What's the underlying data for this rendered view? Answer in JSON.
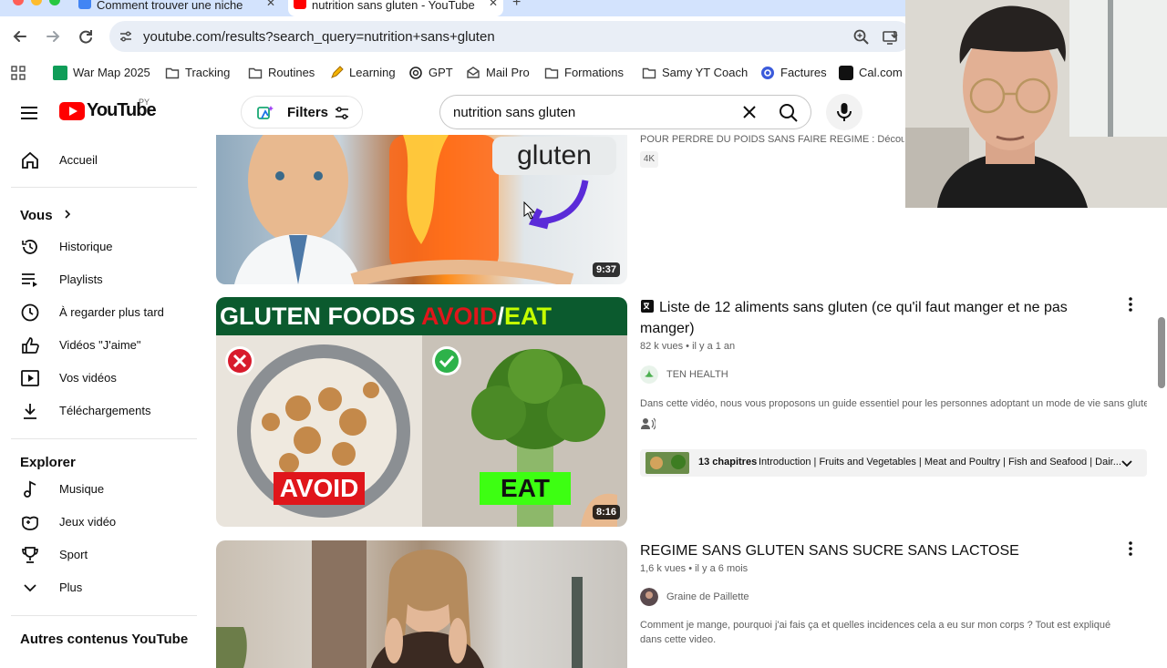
{
  "browser": {
    "tabs": [
      {
        "label": "Comment trouver une niche",
        "active": false
      },
      {
        "label": "nutrition sans gluten - YouTube",
        "active": true
      }
    ],
    "url": "youtube.com/results?search_query=nutrition+sans+gluten",
    "bookmarks": [
      {
        "label": "War Map 2025",
        "icon": "sheets-icon"
      },
      {
        "label": "Tracking",
        "icon": "folder-icon"
      },
      {
        "label": "Routines",
        "icon": "folder-icon"
      },
      {
        "label": "Learning",
        "icon": "pencil-icon"
      },
      {
        "label": "GPT",
        "icon": "openai-icon"
      },
      {
        "label": "Mail Pro",
        "icon": "mail-icon"
      },
      {
        "label": "Formations",
        "icon": "folder-icon"
      },
      {
        "label": "Samy YT Coach",
        "icon": "folder-icon"
      },
      {
        "label": "Factures",
        "icon": "circle-icon"
      },
      {
        "label": "Cal.com",
        "icon": "cal-icon"
      }
    ]
  },
  "header": {
    "logo": "YouTube",
    "country": "PY",
    "filters_label": "Filters",
    "search_query": "nutrition sans gluten"
  },
  "sidebar": {
    "home": "Accueil",
    "you_heading": "Vous",
    "you_items": [
      "Historique",
      "Playlists",
      "À regarder plus tard",
      "Vidéos \"J'aime\"",
      "Vos vidéos",
      "Téléchargements"
    ],
    "explore_heading": "Explorer",
    "explore_items": [
      "Musique",
      "Jeux vidéo",
      "Sport",
      "Plus"
    ],
    "other_heading": "Autres contenus YouTube"
  },
  "results": [
    {
      "duration": "9:37",
      "thumb_text": "gluten",
      "desc": "POUR PERDRE DU POIDS SANS FAIRE REGIME : Découvrez m",
      "badge": "4K"
    },
    {
      "duration": "8:16",
      "thumb_banner": [
        "GLUTEN FOODS ",
        "AVOID",
        "/",
        "EAT"
      ],
      "thumb_avoid": "AVOID",
      "thumb_eat": "EAT",
      "title": "Liste de 12 aliments sans gluten (ce qu'il faut manger et ne pas manger)",
      "views": "82 k vues",
      "age": "il y a 1 an",
      "channel": "TEN HEALTH",
      "desc": "Dans cette vidéo, nous vous proposons un guide essentiel pour les personnes adoptant un mode de vie sans glute...",
      "chapters_count": "13 chapitres",
      "chapters_text": "Introduction | Fruits and Vegetables | Meat and Poultry | Fish and Seafood | Dair..."
    },
    {
      "title": "REGIME SANS GLUTEN SANS SUCRE SANS LACTOSE",
      "views": "1,6 k vues",
      "age": "il y a 6 mois",
      "channel": "Graine de Paillette",
      "desc": "Comment je mange, pourquoi j'ai fais ça et quelles incidences cela a eu sur mon corps ? Tout est expliqué dans cette video."
    }
  ],
  "colors": {
    "yt_red": "#ff0000",
    "tab_strip": "#d3e3fd",
    "url_bar": "#e9eef6",
    "text_secondary": "#606060"
  }
}
